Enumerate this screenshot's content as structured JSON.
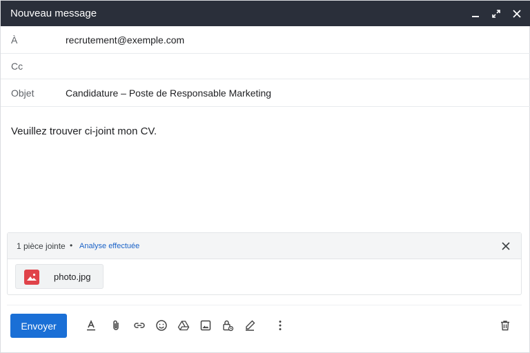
{
  "window": {
    "title": "Nouveau message"
  },
  "fields": {
    "to_label": "À",
    "to_value": "recrutement@exemple.com",
    "cc_label": "Cc",
    "subject_label": "Objet",
    "subject_value": "Candidature – Poste de Responsable Marketing"
  },
  "body": {
    "text": "Veuillez trouver ci-joint mon CV."
  },
  "attachments": {
    "count_label": "1 pièce jointe",
    "separator": "•",
    "scan_status": "Analyse effectuée",
    "files": [
      {
        "name": "photo.jpg",
        "icon": "image-icon"
      }
    ]
  },
  "toolbar": {
    "send_label": "Envoyer",
    "icons": [
      "text-format-icon",
      "attach-icon",
      "link-icon",
      "emoji-icon",
      "drive-icon",
      "image-icon",
      "lock-clock-icon",
      "pen-icon",
      "more-options-icon",
      "trash-icon"
    ]
  },
  "colors": {
    "titlebar": "#2a2f3a",
    "send_button": "#1a6fd6",
    "link": "#1a62c7",
    "image_icon": "#e0434a"
  }
}
